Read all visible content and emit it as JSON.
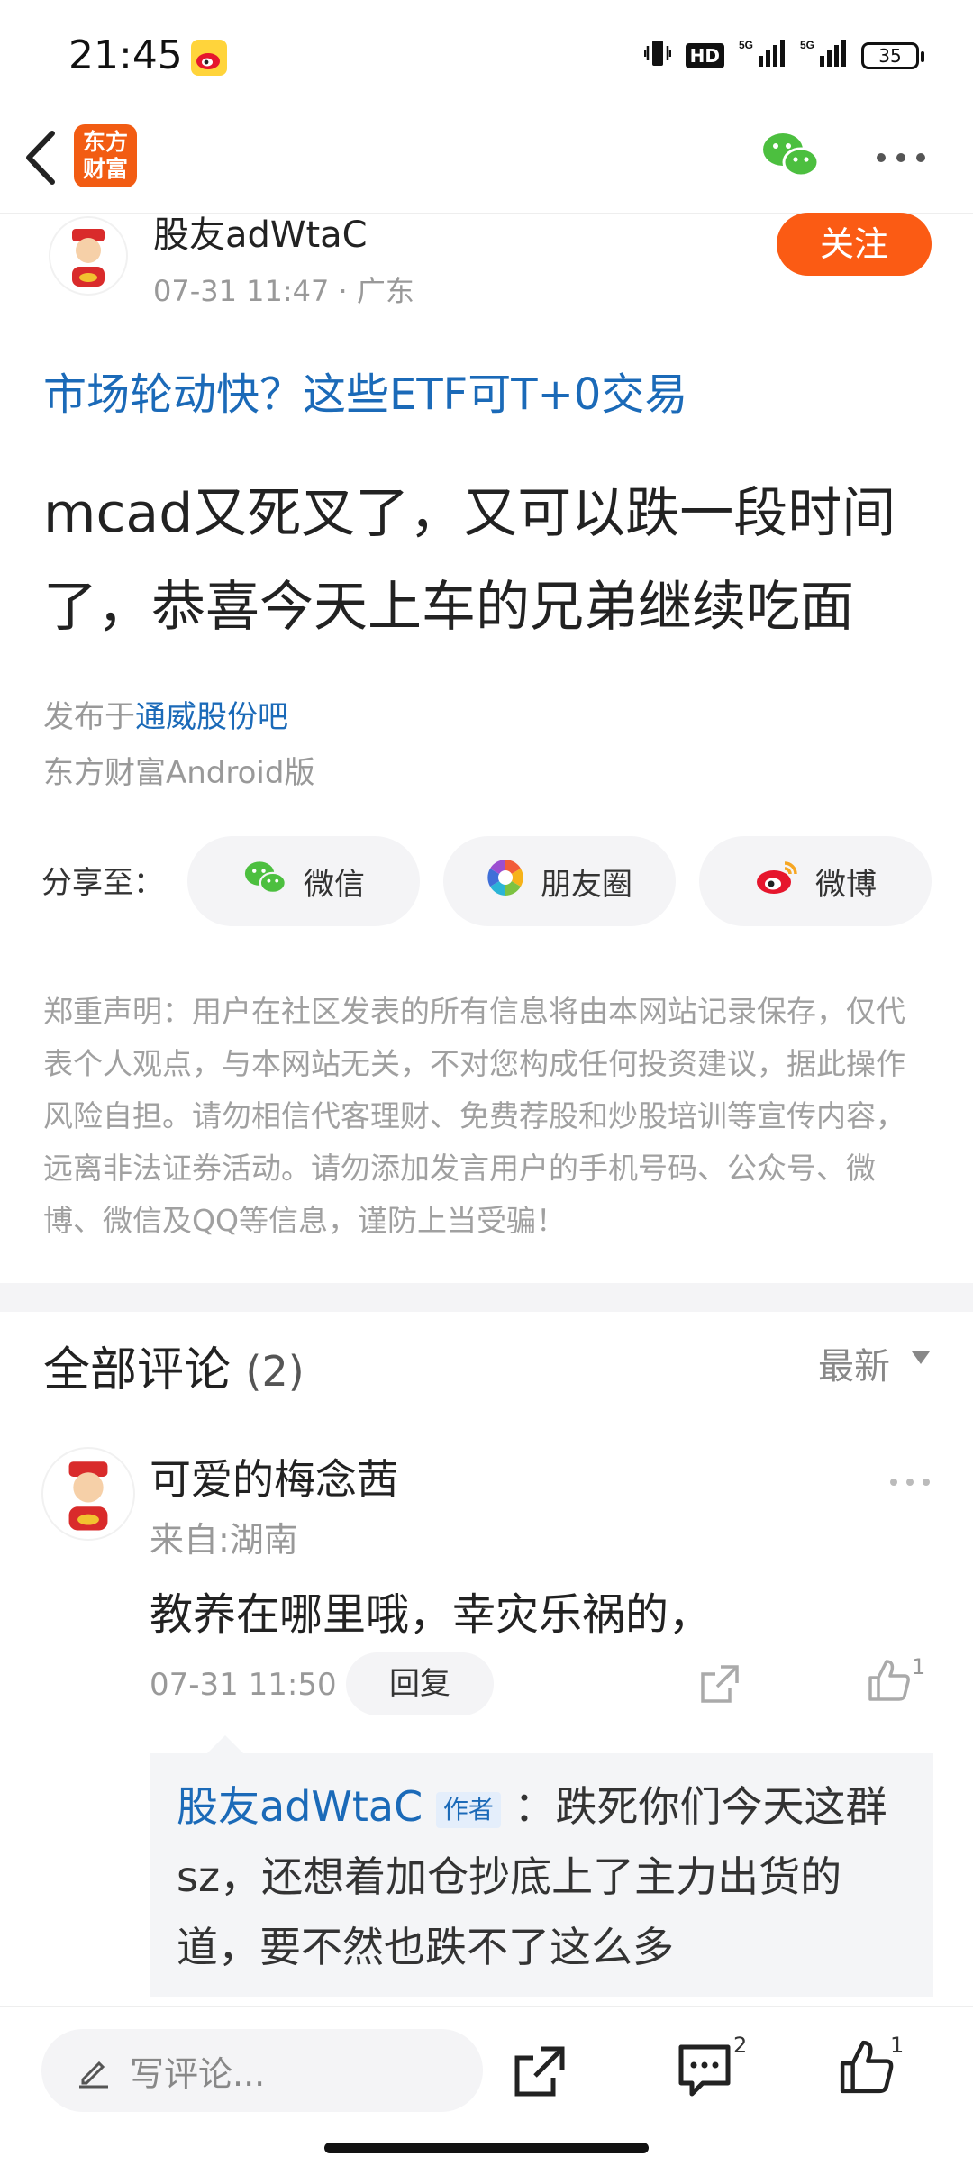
{
  "status_bar": {
    "time": "21:45",
    "battery": "35",
    "hd_label": "HD",
    "signal_label": "5G"
  },
  "nav": {
    "logo_line1": "东方",
    "logo_line2": "财富"
  },
  "post": {
    "author": "股友adWtaC",
    "meta": "07-31 11:47 · 广东",
    "follow_label": "关注",
    "ad_link": "市场轮动快？这些ETF可T+0交易",
    "title": "mcad又死叉了，又可以跌一段时间了，恭喜今天上车的兄弟继续吃面",
    "published_prefix": "发布于",
    "published_bar": "通威股份吧",
    "client": "东方财富Android版"
  },
  "share": {
    "label": "分享至：",
    "wechat": "微信",
    "moments": "朋友圈",
    "weibo": "微博"
  },
  "disclaimer": "郑重声明：用户在社区发表的所有信息将由本网站记录保存，仅代表个人观点，与本网站无关，不对您构成任何投资建议，据此操作风险自担。请勿相信代客理财、免费荐股和炒股培训等宣传内容，远离非法证券活动。请勿添加发言用户的手机号码、公众号、微博、微信及QQ等信息，谨防上当受骗！",
  "comments": {
    "title": "全部评论",
    "count": "(2)",
    "sort": "最新",
    "items": [
      {
        "name": "可爱的梅念茜",
        "location": "来自:湖南",
        "text": "教养在哪里哦，幸灾乐祸的，",
        "time": "07-31 11:50",
        "reply_label": "回复",
        "likes": "1",
        "reply": {
          "name": "股友adWtaC",
          "tag": "作者",
          "text": "：跌死你们今天这群sz，还想着加仓抄底上了主力出货的道，要不然也跌不了这么多"
        }
      }
    ]
  },
  "bottom_bar": {
    "placeholder": "写评论...",
    "comment_count": "2",
    "like_count": "1"
  }
}
